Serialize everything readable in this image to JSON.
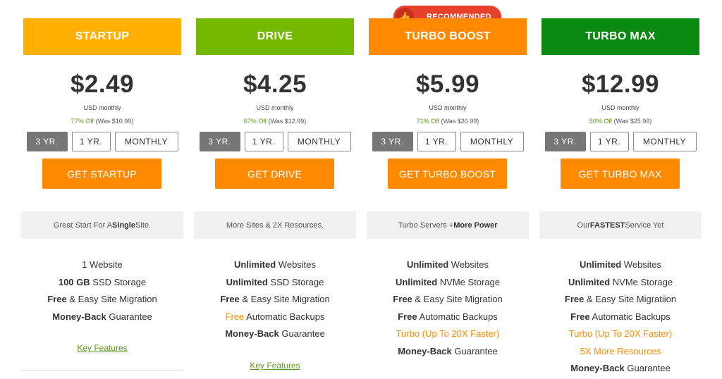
{
  "badge": {
    "label": "RECOMMENDED",
    "icon": "thumbs-up-icon"
  },
  "plans": [
    {
      "name": "STARTUP",
      "color": "#ffb000",
      "price": "$2.49",
      "period": "USD monthly",
      "discount_off": "77% Off",
      "discount_was": "(Was $10.99)",
      "terms": [
        "3 YR.",
        "1 YR.",
        "MONTHLY"
      ],
      "active_term": "3 YR.",
      "cta": "GET STARTUP",
      "tagline_pre": "Great Start For A ",
      "tagline_bold": "Single",
      "tagline_post": " Site.",
      "features": [
        {
          "bold": "",
          "rest": "1 Website"
        },
        {
          "bold": "100 GB",
          "rest": " SSD Storage"
        },
        {
          "bold": "Free",
          "rest": " & Easy Site Migration"
        },
        {
          "bold": "Money-Back",
          "rest": " Guarantee"
        }
      ],
      "link": "Key Features"
    },
    {
      "name": "DRIVE",
      "color": "#72b900",
      "price": "$4.25",
      "period": "USD monthly",
      "discount_off": "67% Off",
      "discount_was": "(Was $12.99)",
      "terms": [
        "3 YR.",
        "1 YR.",
        "MONTHLY"
      ],
      "active_term": "3 YR.",
      "cta": "GET DRIVE",
      "tagline": "More Sites & 2X Resources.",
      "features": [
        {
          "bold": "Unlimited",
          "rest": " Websites"
        },
        {
          "bold": "Unlimited",
          "rest": " SSD Storage"
        },
        {
          "bold": "Free",
          "rest": " & Easy Site Migration"
        },
        {
          "orange": "Free",
          "rest": " Automatic Backups"
        },
        {
          "bold": "Money-Back",
          "rest": " Guarantee"
        }
      ],
      "link": "Key Features"
    },
    {
      "name": "TURBO BOOST",
      "color": "#ff8a00",
      "price": "$5.99",
      "period": "USD monthly",
      "discount_off": "71% Off",
      "discount_was": "(Was $20.99)",
      "terms": [
        "3 YR.",
        "1 YR.",
        "MONTHLY"
      ],
      "active_term": "3 YR.",
      "cta": "GET TURBO BOOST",
      "tagline_pre": "Turbo Servers + ",
      "tagline_bold": "More Power",
      "tagline_post": "",
      "features": [
        {
          "bold": "Unlimited",
          "rest": " Websites"
        },
        {
          "bold": "Unlimited",
          "rest": " NVMe Storage"
        },
        {
          "bold": "Free",
          "rest": " & Easy Site Migration"
        },
        {
          "bold": "Free",
          "rest": " Automatic Backups"
        },
        {
          "all_orange": "Turbo (Up To 20X Faster)"
        },
        {
          "bold": "Money-Back",
          "rest": " Guarantee"
        }
      ]
    },
    {
      "name": "TURBO MAX",
      "color": "#0a8a10",
      "price": "$12.99",
      "period": "USD monthly",
      "discount_off": "50% Off",
      "discount_was": "(Was $25.99)",
      "terms": [
        "3 YR.",
        "1 YR.",
        "MONTHLY"
      ],
      "active_term": "3 YR.",
      "cta": "GET TURBO MAX",
      "tagline_pre": "Our ",
      "tagline_bold": "FASTEST",
      "tagline_post": " Service Yet",
      "features": [
        {
          "bold": "Unlimited",
          "rest": " Websites"
        },
        {
          "bold": "Unlimited",
          "rest": " NVMe Storage"
        },
        {
          "bold": "Free",
          "rest": " & Easy Site Migratiion"
        },
        {
          "bold": "Free",
          "rest": " Automatic Backups"
        },
        {
          "all_orange": "Turbo (Up To 20X Faster)"
        },
        {
          "all_orange": "5X More Resources"
        },
        {
          "bold": "Money-Back",
          "rest": " Guarantee"
        }
      ]
    }
  ]
}
